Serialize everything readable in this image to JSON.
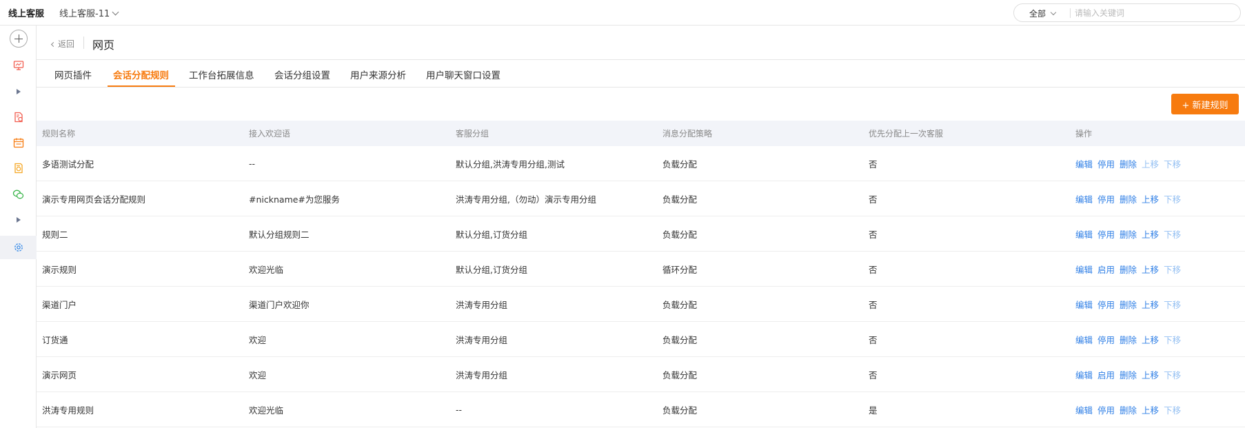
{
  "topbar": {
    "brand": "线上客服",
    "workspace": "线上客服-11",
    "search_scope": "全部",
    "search_placeholder": "请输入关键词"
  },
  "rail": {
    "icons": [
      "add-icon",
      "monitor-icon",
      "expand-arrow-icon",
      "document-icon",
      "calendar-icon",
      "report-icon",
      "chat-bubbles-icon",
      "expand-arrow-icon",
      "settings-gear-icon"
    ],
    "active": "settings-gear-icon"
  },
  "header": {
    "back_label": "返回",
    "title": "网页"
  },
  "tabs": [
    {
      "label": "网页插件"
    },
    {
      "label": "会话分配规则",
      "active": true
    },
    {
      "label": "工作台拓展信息"
    },
    {
      "label": "会话分组设置"
    },
    {
      "label": "用户来源分析"
    },
    {
      "label": "用户聊天窗口设置"
    }
  ],
  "new_rule_button": "+ 新建规则",
  "table": {
    "headers": [
      "规则名称",
      "接入欢迎语",
      "客服分组",
      "消息分配策略",
      "优先分配上一次客服",
      "操作"
    ],
    "rows": [
      {
        "name": "多语测试分配",
        "welcome": "--",
        "group": "默认分组,洪涛专用分组,测试",
        "strategy": "负载分配",
        "prior": "否",
        "ops": [
          "编辑",
          "停用",
          "删除",
          "上移",
          "下移"
        ],
        "up_disabled": true
      },
      {
        "name": "演示专用网页会话分配规则",
        "welcome": "#nickname#为您服务",
        "group": "洪涛专用分组,（勿动）演示专用分组",
        "strategy": "负载分配",
        "prior": "否",
        "ops": [
          "编辑",
          "停用",
          "删除",
          "上移",
          "下移"
        ],
        "up_disabled": false
      },
      {
        "name": "规则二",
        "welcome": "默认分组规则二",
        "group": "默认分组,订货分组",
        "strategy": "负载分配",
        "prior": "否",
        "ops": [
          "编辑",
          "停用",
          "删除",
          "上移",
          "下移"
        ],
        "up_disabled": false
      },
      {
        "name": "演示规则",
        "welcome": "欢迎光临",
        "group": "默认分组,订货分组",
        "strategy": "循环分配",
        "prior": "否",
        "ops": [
          "编辑",
          "启用",
          "删除",
          "上移",
          "下移"
        ],
        "up_disabled": false
      },
      {
        "name": "渠道门户",
        "welcome": "渠道门户欢迎你",
        "group": "洪涛专用分组",
        "strategy": "负载分配",
        "prior": "否",
        "ops": [
          "编辑",
          "停用",
          "删除",
          "上移",
          "下移"
        ],
        "up_disabled": false
      },
      {
        "name": "订货通",
        "welcome": "欢迎",
        "group": "洪涛专用分组",
        "strategy": "负载分配",
        "prior": "否",
        "ops": [
          "编辑",
          "停用",
          "删除",
          "上移",
          "下移"
        ],
        "up_disabled": false
      },
      {
        "name": "演示网页",
        "welcome": "欢迎",
        "group": "洪涛专用分组",
        "strategy": "负载分配",
        "prior": "否",
        "ops": [
          "编辑",
          "启用",
          "删除",
          "上移",
          "下移"
        ],
        "up_disabled": false
      },
      {
        "name": "洪涛专用规则",
        "welcome": "欢迎光临",
        "group": "--",
        "strategy": "负载分配",
        "prior": "是",
        "ops": [
          "编辑",
          "停用",
          "删除",
          "上移",
          "下移"
        ],
        "up_disabled": false
      }
    ]
  },
  "colors": {
    "accent": "#f77b0f",
    "link": "#2f7fe6",
    "link_disabled": "#93bff2",
    "header_bg": "#f2f4f9"
  }
}
